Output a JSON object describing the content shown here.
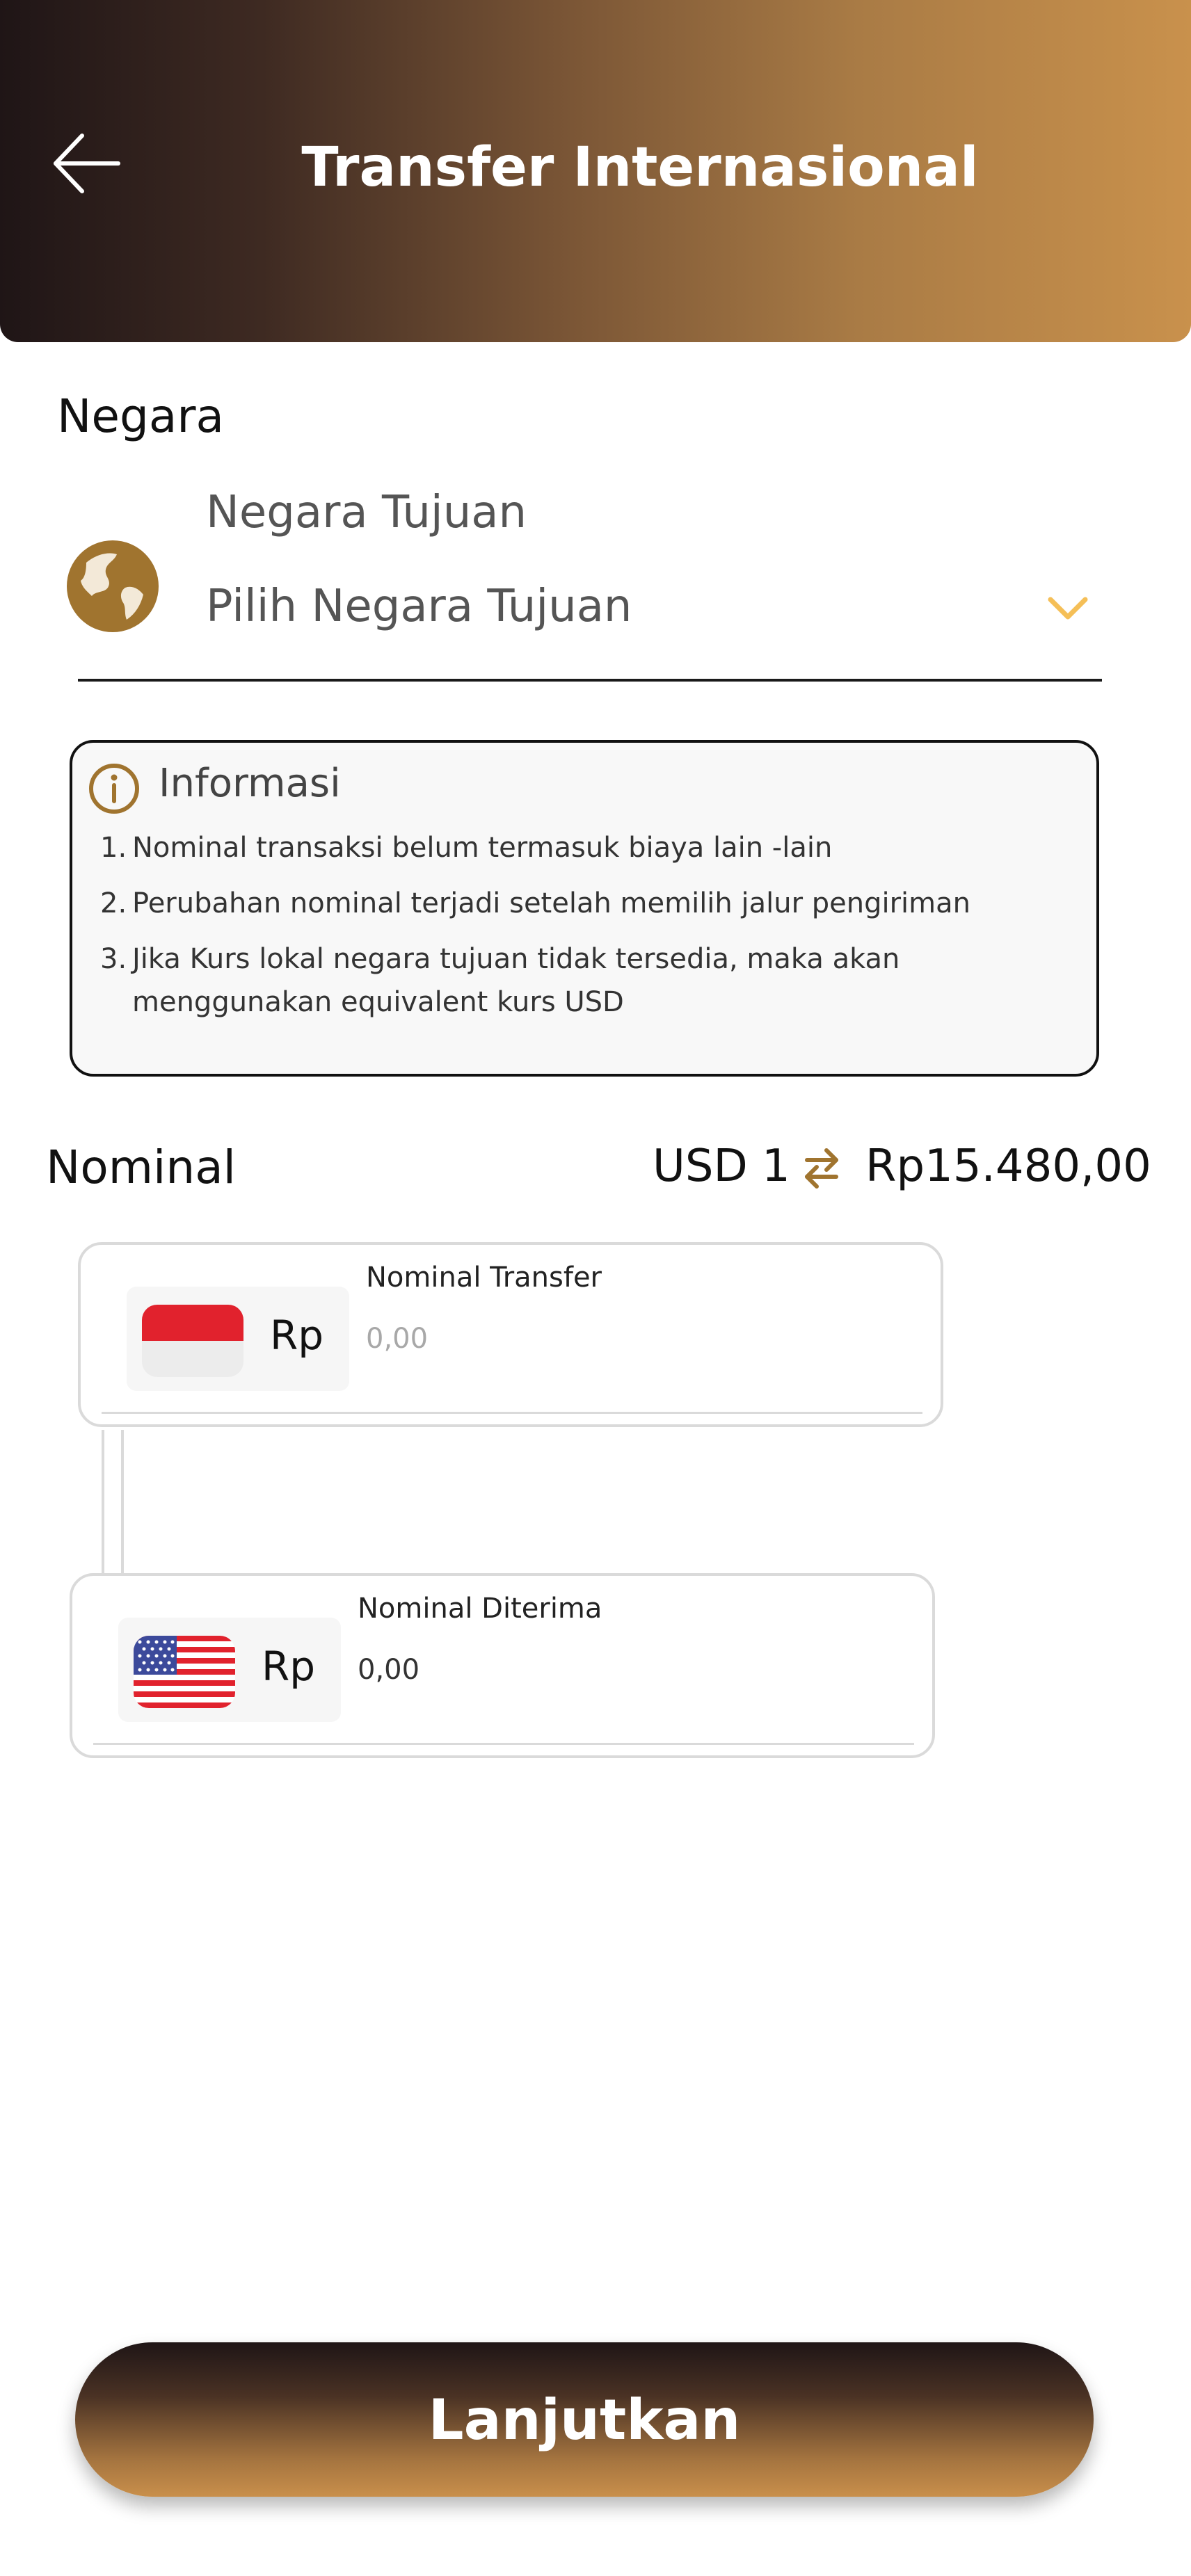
{
  "header": {
    "title": "Transfer Internasional",
    "back_icon": "arrow-left-icon"
  },
  "country": {
    "section_label": "Negara",
    "caption": "Negara Tujuan",
    "placeholder": "Pilih Negara Tujuan",
    "icon": "globe-icon",
    "dropdown_icon": "chevron-down-icon"
  },
  "info": {
    "title": "Informasi",
    "icon": "info-icon",
    "items": [
      {
        "num": "1.",
        "text": "Nominal transaksi belum termasuk biaya lain -lain"
      },
      {
        "num": "2.",
        "text": "Perubahan nominal terjadi setelah memilih jalur pengiriman"
      },
      {
        "num": "3.",
        "text": "Jika Kurs lokal negara tujuan tidak tersedia, maka akan menggunakan equivalent kurs USD"
      }
    ]
  },
  "nominal": {
    "label": "Nominal",
    "rate_from": "USD 1",
    "rate_to": "Rp15.480,00",
    "swap_icon": "swap-arrows-icon"
  },
  "transfer_card": {
    "flag": "indonesia-flag-icon",
    "currency": "Rp",
    "caption": "Nominal Transfer",
    "value": "0,00"
  },
  "received_card": {
    "flag": "usa-flag-icon",
    "currency": "Rp",
    "caption": "Nominal Diterima",
    "value": "0,00"
  },
  "actions": {
    "continue_label": "Lanjutkan"
  },
  "colors": {
    "accent_gold": "#a0742f",
    "chevron": "#f5bf57",
    "header_dark": "#1f1516",
    "header_light": "#c9914c"
  }
}
